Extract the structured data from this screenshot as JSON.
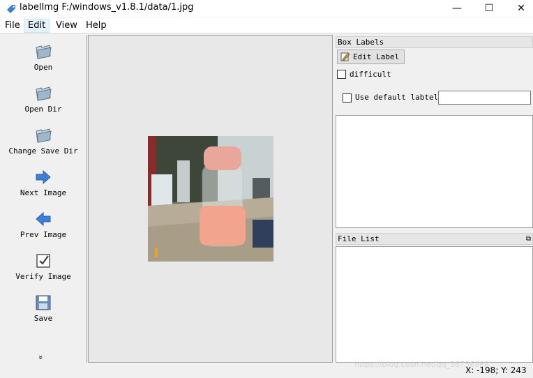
{
  "window": {
    "title": "labelImg F:/windows_v1.8.1/data/1.jpg",
    "minimize_glyph": "—",
    "maximize_glyph": "☐",
    "close_glyph": "✕"
  },
  "menu": [
    {
      "label": "File"
    },
    {
      "label": "Edit",
      "active": true
    },
    {
      "label": "View"
    },
    {
      "label": "Help"
    }
  ],
  "toolbar": {
    "items": [
      {
        "label": "Open",
        "icon": "folder-icon"
      },
      {
        "label": "Open Dir",
        "icon": "folder-icon"
      },
      {
        "label": "Change Save Dir",
        "icon": "folder-icon"
      },
      {
        "label": "Next Image",
        "icon": "arrow-right-icon"
      },
      {
        "label": "Prev Image",
        "icon": "arrow-left-icon"
      },
      {
        "label": "Verify Image",
        "icon": "checkbox-icon"
      },
      {
        "label": "Save",
        "icon": "floppy-icon"
      }
    ],
    "more_glyph": "»"
  },
  "box_labels": {
    "title": "Box Labels",
    "edit_label_button": "Edit Label",
    "difficult": {
      "label": "difficult",
      "checked": false
    },
    "use_default": {
      "label": "Use default labtel",
      "checked": false,
      "value": ""
    }
  },
  "file_list": {
    "title": "File List",
    "float_glyph": "⧉"
  },
  "status": {
    "coords": "X: -198; Y: 243",
    "watermark": "https://blog.csdn.net/qq_36756968"
  },
  "colors": {
    "arrow_blue": "#3d7fd6",
    "folder_blue": "#9fb8cc",
    "jar_pink": "#f2a48f"
  }
}
